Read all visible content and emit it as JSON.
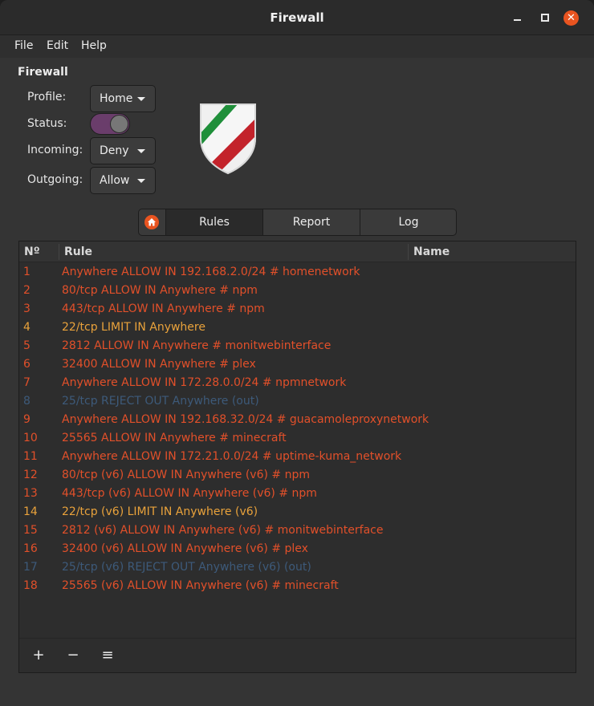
{
  "window": {
    "title": "Firewall"
  },
  "menu": {
    "file": "File",
    "edit": "Edit",
    "help": "Help"
  },
  "section": {
    "title": "Firewall"
  },
  "form": {
    "profile_label": "Profile:",
    "profile_value": "Home",
    "status_label": "Status:",
    "status_on": true,
    "incoming_label": "Incoming:",
    "incoming_value": "Deny",
    "outgoing_label": "Outgoing:",
    "outgoing_value": "Allow"
  },
  "tabs": {
    "rules": "Rules",
    "report": "Report",
    "log": "Log",
    "active": "Rules"
  },
  "table": {
    "headers": {
      "num": "Nº",
      "rule": "Rule",
      "name": "Name"
    },
    "rows": [
      {
        "num": "1",
        "rule": "Anywhere ALLOW IN 192.168.2.0/24 # homenetwork",
        "kind": "allow"
      },
      {
        "num": "2",
        "rule": "80/tcp ALLOW IN Anywhere # npm",
        "kind": "allow"
      },
      {
        "num": "3",
        "rule": "443/tcp ALLOW IN Anywhere # npm",
        "kind": "allow"
      },
      {
        "num": "4",
        "rule": "22/tcp LIMIT IN Anywhere",
        "kind": "limit"
      },
      {
        "num": "5",
        "rule": "2812 ALLOW IN Anywhere # monitwebinterface",
        "kind": "allow"
      },
      {
        "num": "6",
        "rule": "32400 ALLOW IN Anywhere # plex",
        "kind": "allow"
      },
      {
        "num": "7",
        "rule": "Anywhere ALLOW IN 172.28.0.0/24 # npmnetwork",
        "kind": "allow"
      },
      {
        "num": "8",
        "rule": "25/tcp REJECT OUT Anywhere (out)",
        "kind": "reject"
      },
      {
        "num": "9",
        "rule": "Anywhere ALLOW IN 192.168.32.0/24 # guacamoleproxynetwork",
        "kind": "allow"
      },
      {
        "num": "10",
        "rule": "25565 ALLOW IN Anywhere # minecraft",
        "kind": "allow"
      },
      {
        "num": "11",
        "rule": "Anywhere ALLOW IN 172.21.0.0/24 # uptime-kuma_network",
        "kind": "allow"
      },
      {
        "num": "12",
        "rule": "80/tcp (v6) ALLOW IN Anywhere (v6) # npm",
        "kind": "allow"
      },
      {
        "num": "13",
        "rule": "443/tcp (v6) ALLOW IN Anywhere (v6) # npm",
        "kind": "allow"
      },
      {
        "num": "14",
        "rule": "22/tcp (v6) LIMIT IN Anywhere (v6)",
        "kind": "limit"
      },
      {
        "num": "15",
        "rule": "2812 (v6) ALLOW IN Anywhere (v6) # monitwebinterface",
        "kind": "allow"
      },
      {
        "num": "16",
        "rule": "32400 (v6) ALLOW IN Anywhere (v6) # plex",
        "kind": "allow"
      },
      {
        "num": "17",
        "rule": "25/tcp (v6) REJECT OUT Anywhere (v6) (out)",
        "kind": "reject"
      },
      {
        "num": "18",
        "rule": "25565 (v6) ALLOW IN Anywhere (v6) # minecraft",
        "kind": "allow"
      }
    ]
  },
  "toolbar": {
    "add": "+",
    "remove": "−",
    "menu": "≡"
  },
  "colors": {
    "allow": "#e2502a",
    "limit": "#e9a23b",
    "reject": "#3d5a7a",
    "accent": "#e95420",
    "toggle": "#6a3d6b"
  },
  "icons": {
    "close": "close-icon",
    "minimize": "minimize-icon",
    "maximize": "maximize-icon",
    "home": "home-icon",
    "shield": "gufw-shield-logo"
  }
}
